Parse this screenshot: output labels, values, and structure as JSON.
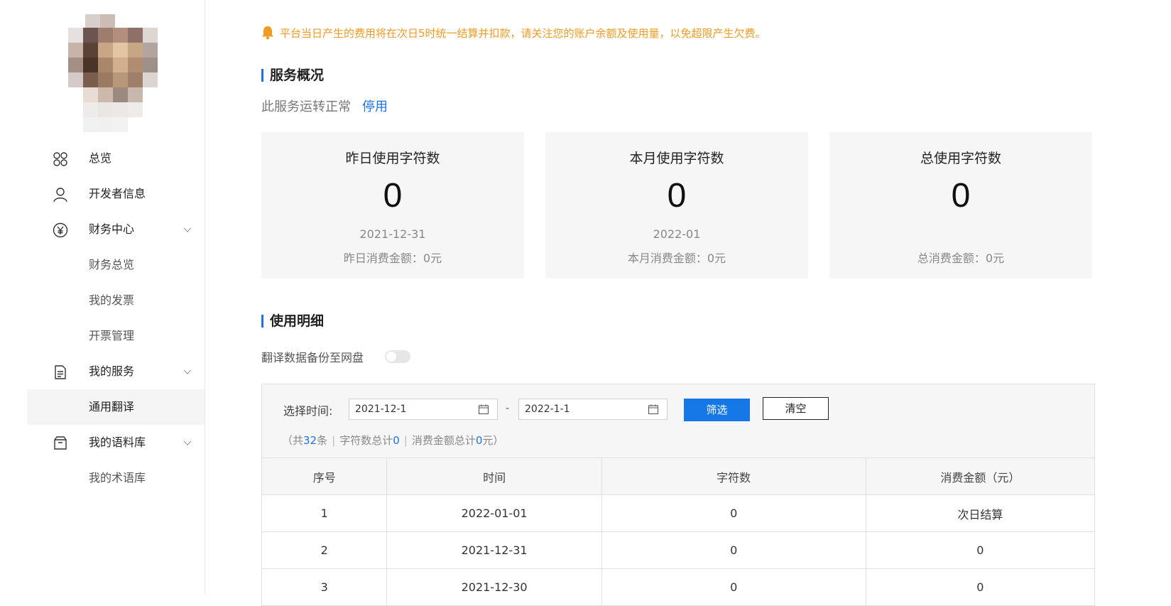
{
  "sidebar": {
    "items": [
      {
        "label": "总览",
        "icon": "grid-icon",
        "level": 1
      },
      {
        "label": "开发者信息",
        "icon": "user-icon",
        "level": 1
      },
      {
        "label": "财务中心",
        "icon": "yen-circle-icon",
        "level": 1,
        "expandable": true
      },
      {
        "label": "财务总览",
        "level": 2
      },
      {
        "label": "我的发票",
        "level": 2
      },
      {
        "label": "开票管理",
        "level": 2
      },
      {
        "label": "我的服务",
        "icon": "document-icon",
        "level": 1,
        "expandable": true
      },
      {
        "label": "通用翻译",
        "level": 2,
        "active": true
      },
      {
        "label": "我的语料库",
        "icon": "box-icon",
        "level": 1,
        "expandable": true
      },
      {
        "label": "我的术语库",
        "level": 2
      }
    ]
  },
  "notice": {
    "text": "平台当日产生的费用将在次日5时统一结算并扣款，请关注您的账户余额及使用量，以免超限产生欠费。",
    "icon": "bell-icon",
    "color": "#f39b21"
  },
  "overview": {
    "title": "服务概况",
    "status_text": "此服务运转正常",
    "action_link": "停用"
  },
  "cards": [
    {
      "title": "昨日使用字符数",
      "value": "0",
      "date": "2021-12-31",
      "money": "昨日消费金额：0元"
    },
    {
      "title": "本月使用字符数",
      "value": "0",
      "date": "2022-01",
      "money": "本月消费金额：0元"
    },
    {
      "title": "总使用字符数",
      "value": "0",
      "date": "",
      "money": "总消费金额：0元"
    }
  ],
  "details": {
    "title": "使用明细",
    "toggle_label": "翻译数据备份至网盘",
    "toggle_on": false,
    "filter": {
      "label": "选择时间:",
      "start_date": "2021-12-1",
      "end_date": "2022-1-1",
      "dash": "-",
      "filter_button": "筛选",
      "clear_button": "清空"
    },
    "summary": {
      "prefix": "（共",
      "count": "32",
      "count_suffix": "条",
      "chars_prefix": "字符数总计",
      "chars_total": "0",
      "money_prefix": "消费金额总计",
      "money_total": "0",
      "money_suffix": "元）",
      "separator": "|"
    },
    "table": {
      "columns": [
        "序号",
        "时间",
        "字符数",
        "消费金额（元）"
      ],
      "rows": [
        [
          "1",
          "2022-01-01",
          "0",
          "次日结算"
        ],
        [
          "2",
          "2021-12-31",
          "0",
          "0"
        ],
        [
          "3",
          "2021-12-30",
          "0",
          "0"
        ]
      ]
    }
  },
  "colors": {
    "accent": "#1a73e8",
    "primary_button": "#1677e6",
    "warning": "#f39b21",
    "card_bg": "#f6f6f6"
  }
}
